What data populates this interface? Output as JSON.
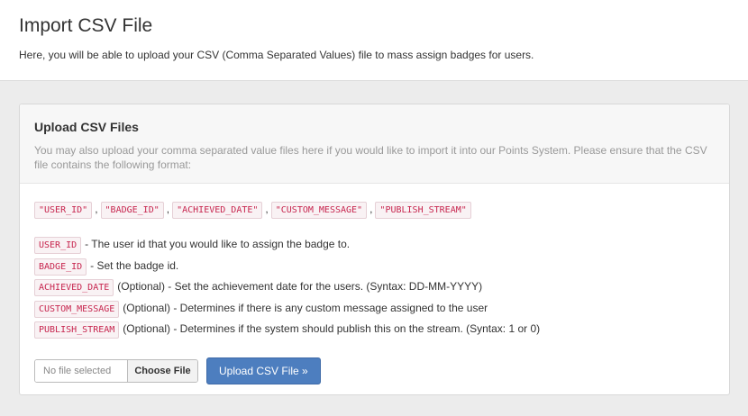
{
  "header": {
    "title": "Import CSV File",
    "description": "Here, you will be able to upload your CSV (Comma Separated Values) file to mass assign badges for users."
  },
  "panel": {
    "title": "Upload CSV Files",
    "description": "You may also upload your comma separated value files here if you would like to import it into our Points System. Please ensure that the CSV file contains the following format:",
    "format": [
      "\"USER_ID\"",
      "\"BADGE_ID\"",
      "\"ACHIEVED_DATE\"",
      "\"CUSTOM_MESSAGE\"",
      "\"PUBLISH_STREAM\""
    ],
    "separator": ",",
    "fields": [
      {
        "code": "USER_ID",
        "text": "- The user id that you would like to assign the badge to."
      },
      {
        "code": "BADGE_ID",
        "text": "- Set the badge id."
      },
      {
        "code": "ACHIEVED_DATE",
        "text": "(Optional) - Set the achievement date for the users. (Syntax: DD-MM-YYYY)"
      },
      {
        "code": "CUSTOM_MESSAGE",
        "text": "(Optional) - Determines if there is any custom message assigned to the user"
      },
      {
        "code": "PUBLISH_STREAM",
        "text": "(Optional) - Determines if the system should publish this on the stream. (Syntax: 1 or 0)"
      }
    ]
  },
  "upload": {
    "file_status": "No file selected",
    "choose_label": "Choose File",
    "submit_label": "Upload CSV File »"
  }
}
